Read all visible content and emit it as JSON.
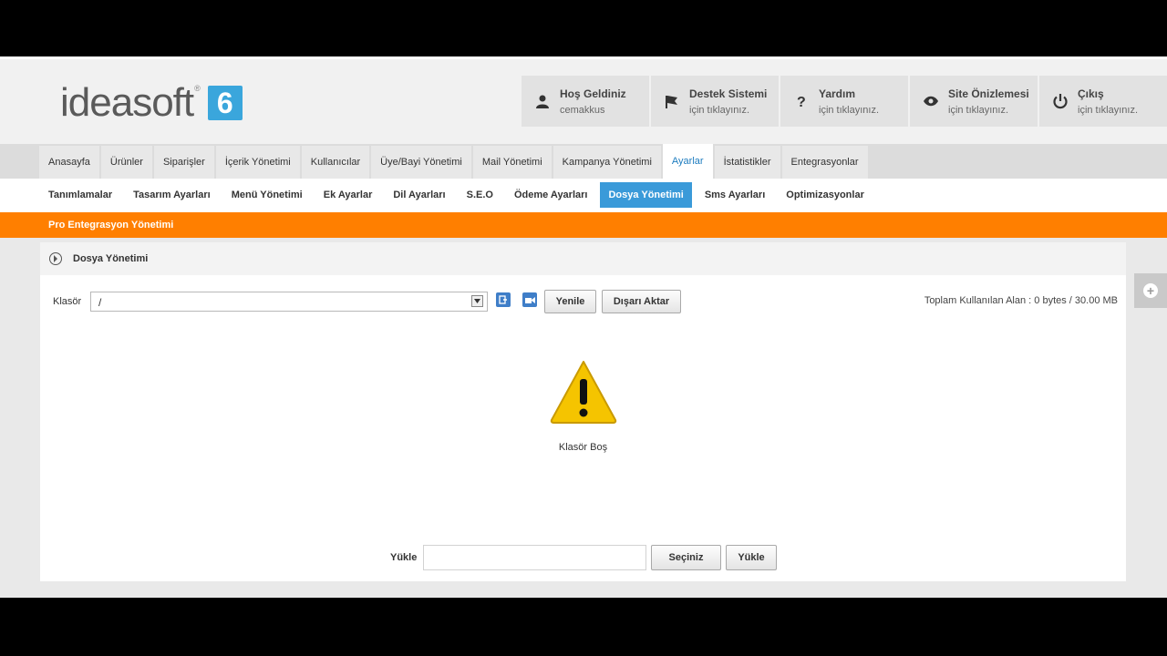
{
  "logo": {
    "text": "ideasoft",
    "reg": "®",
    "version": "6"
  },
  "header_buttons": [
    {
      "icon": "user-icon",
      "title": "Hoş Geldiniz",
      "sub": "cemakkus"
    },
    {
      "icon": "flag-icon",
      "title": "Destek Sistemi",
      "sub": "için tıklayınız."
    },
    {
      "icon": "question-icon",
      "title": "Yardım",
      "sub": "için tıklayınız."
    },
    {
      "icon": "eye-icon",
      "title": "Site Önizlemesi",
      "sub": "için tıklayınız."
    },
    {
      "icon": "power-icon",
      "title": "Çıkış",
      "sub": "için tıklayınız."
    }
  ],
  "nav": {
    "items": [
      "Anasayfa",
      "Ürünler",
      "Siparişler",
      "İçerik Yönetimi",
      "Kullanıcılar",
      "Üye/Bayi Yönetimi",
      "Mail Yönetimi",
      "Kampanya Yönetimi",
      "Ayarlar",
      "İstatistikler",
      "Entegrasyonlar"
    ],
    "active": "Ayarlar"
  },
  "subnav": {
    "items": [
      "Tanımlamalar",
      "Tasarım Ayarları",
      "Menü Yönetimi",
      "Ek Ayarlar",
      "Dil Ayarları",
      "S.E.O",
      "Ödeme Ayarları",
      "Dosya Yönetimi",
      "Sms Ayarları",
      "Optimizasyonlar"
    ],
    "active": "Dosya Yönetimi"
  },
  "orange_bar": {
    "label": "Pro Entegrasyon Yönetimi"
  },
  "panel": {
    "title": "Dosya Yönetimi",
    "folder_label": "Klasör",
    "folder_value": "/",
    "refresh_button": "Yenile",
    "export_button": "Dışarı Aktar",
    "usage_text": "Toplam Kullanılan Alan : 0 bytes / 30.00 MB",
    "empty_message": "Klasör Boş",
    "upload_label": "Yükle",
    "choose_button": "Seçiniz",
    "upload_button": "Yükle"
  },
  "colors": {
    "accent": "#3a9ad9",
    "orange": "#ff7f00",
    "warning": "#f5c400"
  }
}
